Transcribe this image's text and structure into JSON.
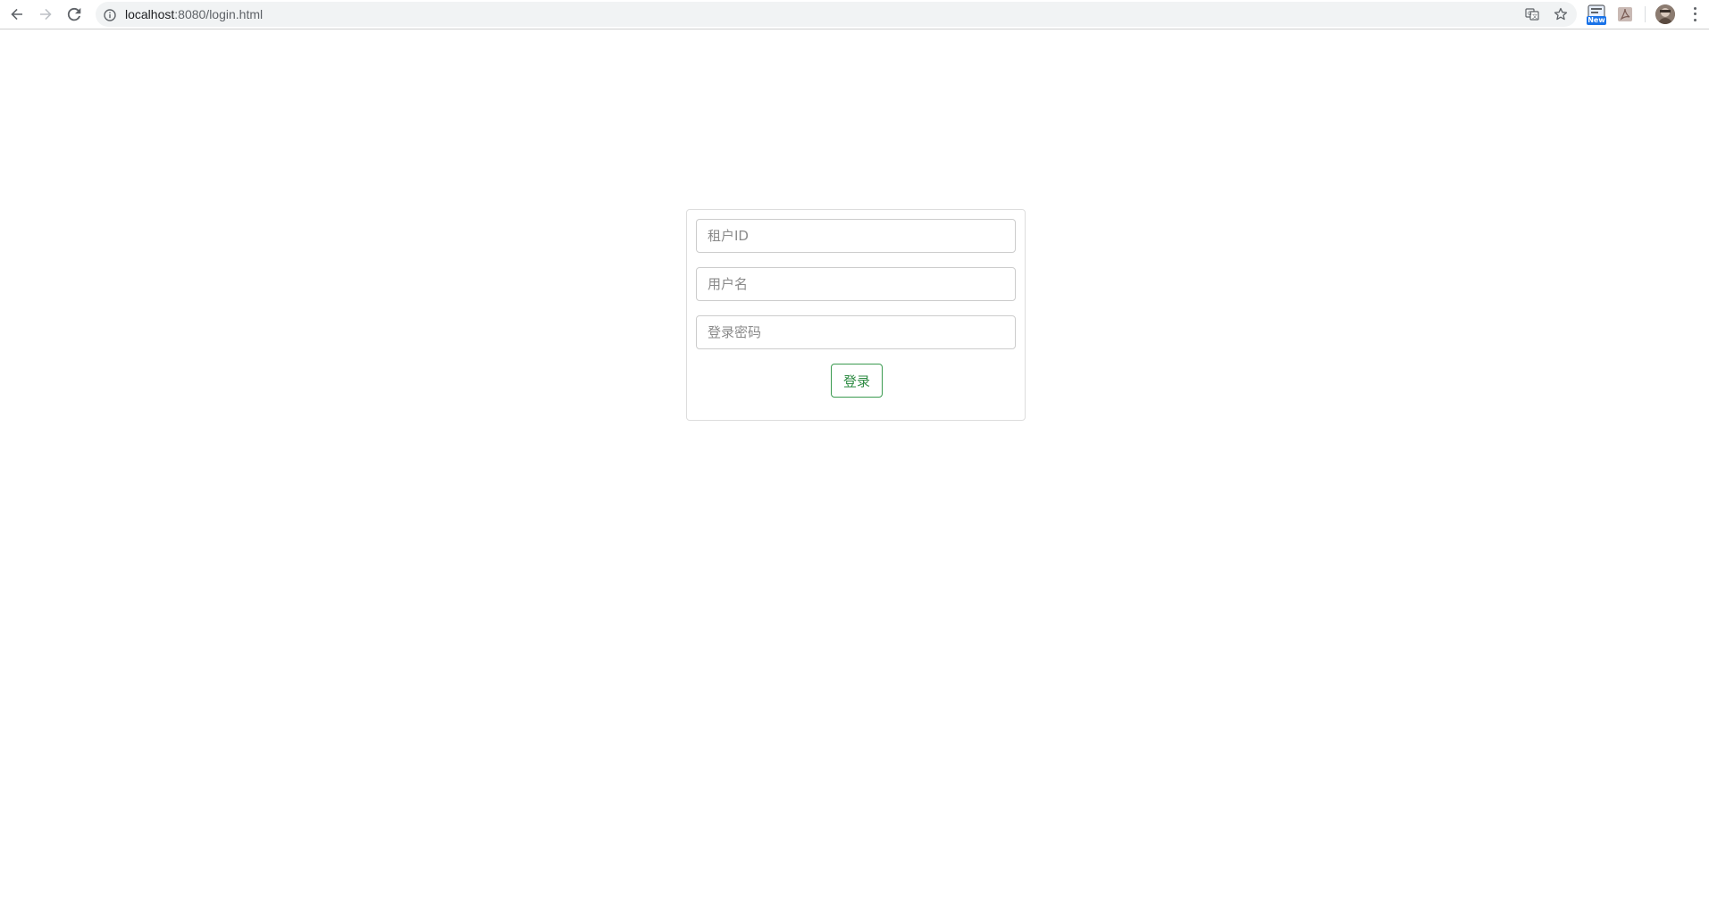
{
  "browser": {
    "url_host": "localhost",
    "url_path": ":8080/login.html",
    "new_badge": "New"
  },
  "login": {
    "tenant_placeholder": "租户ID",
    "username_placeholder": "用户名",
    "password_placeholder": "登录密码",
    "submit_label": "登录"
  },
  "icons": {
    "back": "arrow-left-icon",
    "forward": "arrow-right-icon",
    "reload": "reload-icon",
    "info": "info-icon",
    "translate": "translate-icon",
    "bookmark": "star-icon",
    "extension_new": "extension-new-icon",
    "pdf": "pdf-icon",
    "avatar": "avatar",
    "menu": "more-vertical-icon"
  },
  "colors": {
    "accent_green": "#3a9a4f",
    "omnibox_bg": "#f1f3f4"
  }
}
